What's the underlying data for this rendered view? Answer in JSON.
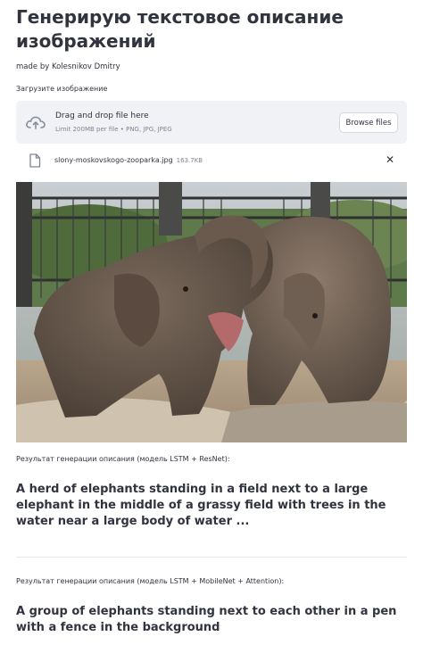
{
  "header": {
    "title_line1": "Генерирую текстовое описание",
    "title_line2": "изображений",
    "author": "made by Kolesnikov Dmitry"
  },
  "uploader": {
    "label": "Загрузите изображение",
    "drop_title": "Drag and drop file here",
    "drop_limit": "Limit 200MB per file • PNG, JPG, JPEG",
    "browse_label": "Browse files"
  },
  "file": {
    "name": "slony-moskovskogo-zooparka.jpg",
    "size": "163.7KB",
    "close_glyph": "✕"
  },
  "results": [
    {
      "label": "Результат генерации описания (модель LSTM + ResNet):",
      "text": "A herd of elephants standing in a field next to a large elephant in the middle of a grassy field with trees in the water near a large body of water ..."
    },
    {
      "label": "Результат генерации описания (модель LSTM + MobileNet + Attention):",
      "text": "A group of elephants standing next to each other in a pen with a fence in the background"
    }
  ],
  "colors": {
    "text": "#31333f",
    "muted": "#808495",
    "uploader_bg": "#f0f2f6"
  }
}
